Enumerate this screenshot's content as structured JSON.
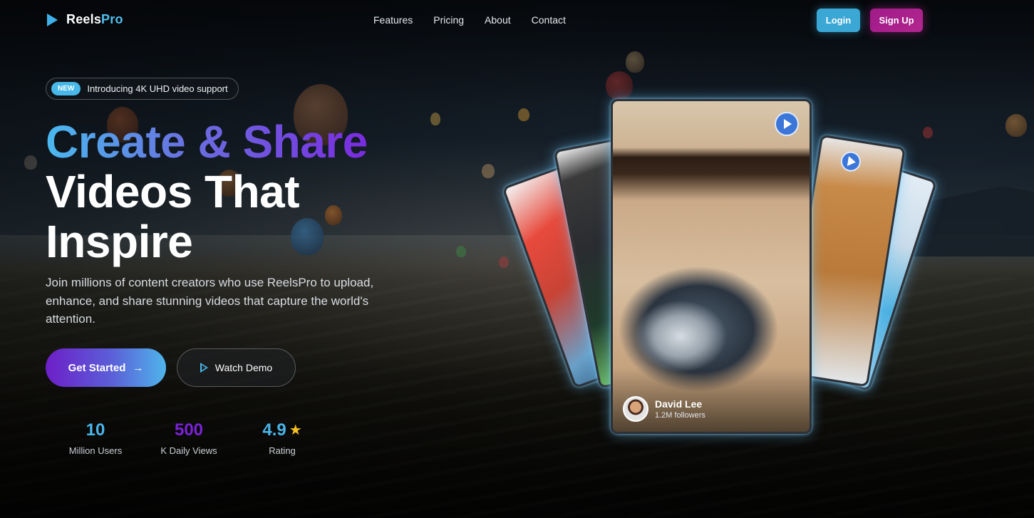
{
  "brand": {
    "name_main": "Reels",
    "name_accent": "Pro"
  },
  "nav": {
    "links": [
      "Features",
      "Pricing",
      "About",
      "Contact"
    ],
    "login_label": "Login",
    "signup_label": "Sign Up"
  },
  "hero": {
    "badge_pill": "NEW",
    "badge_text": "Introducing 4K UHD video support",
    "headline_line1": "Create & Share",
    "headline_line2": "Videos That",
    "headline_line3": "Inspire",
    "subtext": "Join millions of content creators who use ReelsPro to upload, enhance, and share stunning videos that capture the world's attention.",
    "primary_cta": "Get Started",
    "primary_cta_icon": "→",
    "secondary_cta": "Watch Demo"
  },
  "stats": [
    {
      "value": "10",
      "label": "Million Users",
      "color": "#4ab5ea"
    },
    {
      "value": "500",
      "label": "K Daily Views",
      "color": "#7a22d6"
    },
    {
      "value": "4.9",
      "label": "Rating",
      "color": "#4ab5ea",
      "icon": "★"
    }
  ],
  "featured_reel": {
    "author_name": "David Lee",
    "author_followers": "1.2M followers"
  },
  "colors": {
    "accent_blue": "#3fb0ea",
    "accent_purple": "#7a2be0",
    "signup_magenta": "#a01b8a",
    "login_blue": "#3aa7d4"
  }
}
